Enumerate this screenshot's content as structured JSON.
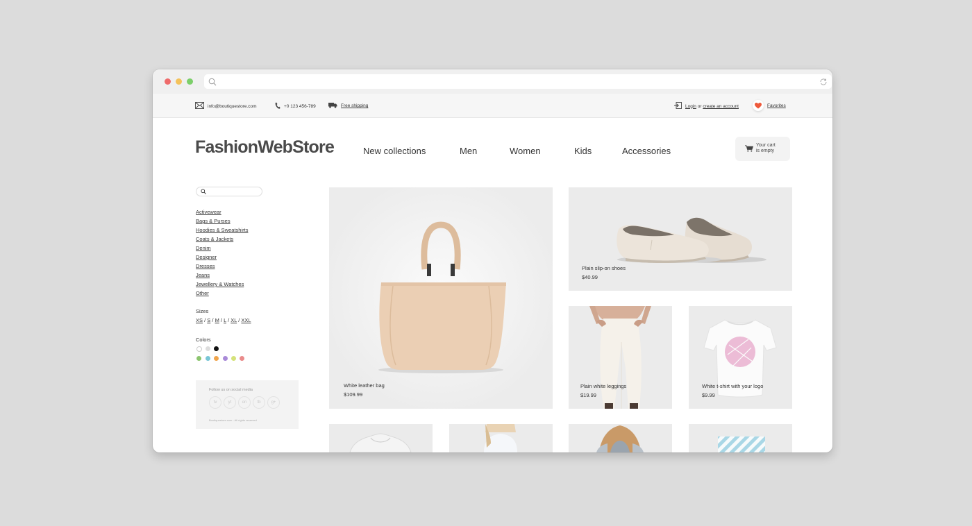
{
  "topbar": {
    "email": "info@boutiquestore.com",
    "phone": "+0 123 456-789",
    "shipping": "Free shipping",
    "login": "Login",
    "login_or": "or",
    "create_account": "create an account",
    "favorites": "Favorites"
  },
  "header": {
    "logo": "FashionWebStore",
    "nav": [
      "New collections",
      "Men",
      "Women",
      "Kids",
      "Accessories"
    ],
    "cart_line1": "Your cart",
    "cart_line2": "is empty"
  },
  "sidebar": {
    "search_placeholder": "",
    "categories": [
      "Activewear",
      "Bags & Purses",
      "Hoodies & Sweatshirts",
      "Coats & Jackets",
      "Denim",
      "Designer",
      "Dresses",
      "Jeans",
      "Jewellery & Watches",
      "Other"
    ],
    "sizes_label": "Sizes",
    "sizes": [
      "XS",
      "S",
      "M",
      "L",
      "XL",
      "XXL"
    ],
    "colors_label": "Colors",
    "colors": [
      "#ffffff",
      "#dddddd",
      "#111111",
      "#8cc56f",
      "#79c6d6",
      "#f0a54d",
      "#a98ad8",
      "#d5e27a",
      "#ea8b8b"
    ],
    "social_label": "Follow us on social media",
    "social_icons": [
      "tv",
      "yt",
      "on",
      "tb",
      "g+"
    ],
    "copyright": "Boutiquestore.com - All rights reserved"
  },
  "products": [
    {
      "name": "White leather bag",
      "price": "$109.99"
    },
    {
      "name": "Plain slip-on shoes",
      "price": "$40.99"
    },
    {
      "name": "Plain white leggings",
      "price": "$19.99"
    },
    {
      "name": "White t-shirt with your logo",
      "price": "$9.99"
    }
  ],
  "colors": {
    "favorite_heart": "#ee5a3c",
    "product_bg": "#ebebeb",
    "bag": "#ebcfb4",
    "shoes": "#e6ddd2",
    "tshirt_logo": "#ecbcd6"
  }
}
